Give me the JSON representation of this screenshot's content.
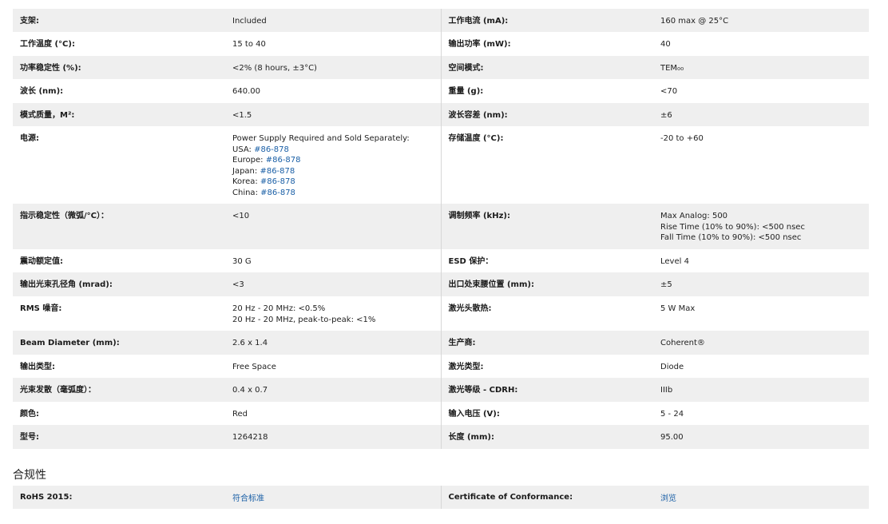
{
  "specs": [
    {
      "l1": "支架:",
      "v1": [
        "Included"
      ],
      "l2": "工作电流 (mA):",
      "v2": [
        "160 max @ 25°C"
      ],
      "h": 29
    },
    {
      "l1": "工作温度 (°C):",
      "v1": [
        "15 to 40"
      ],
      "l2": "输出功率 (mW):",
      "v2": [
        "40"
      ],
      "h": 30
    },
    {
      "l1": "功率稳定性 (%):",
      "v1": [
        "<2% (8 hours, ±3°C)"
      ],
      "l2": "空间模式:",
      "v2": [
        "TEM₀₀"
      ],
      "h": 29
    },
    {
      "l1": "波长 (nm):",
      "v1": [
        "640.00"
      ],
      "l2": "重量 (g):",
      "v2": [
        "<70"
      ],
      "h": 30
    },
    {
      "l1": "模式质量，M²:",
      "v1": [
        "<1.5"
      ],
      "l2": "波长容差 (nm):",
      "v2": [
        "±6"
      ],
      "h": 29
    },
    {
      "l1": "电源:",
      "v1": [
        [
          "Power Supply Required and Sold Separately:"
        ],
        [
          "USA: ",
          "#86-878"
        ],
        [
          "Europe: ",
          "#86-878"
        ],
        [
          "Japan: ",
          "#86-878"
        ],
        [
          "Korea: ",
          "#86-878"
        ],
        [
          "China: ",
          "#86-878"
        ]
      ],
      "l2": "存储温度 (°C):",
      "v2": [
        "-20 to +60"
      ],
      "h": 97
    },
    {
      "l1": "指示稳定性（微弧/°C）：",
      "v1": [
        "<10"
      ],
      "l2": "调制频率 (kHz):",
      "v2": [
        "Max Analog: 500",
        "Rise Time (10% to 90%): <500 nsec",
        "Fall Time (10% to 90%): <500 nsec"
      ],
      "h": 57
    },
    {
      "l1": "震动额定值:",
      "v1": [
        "30 G"
      ],
      "l2": "ESD 保护：",
      "v2": [
        "Level 4"
      ],
      "h": 29
    },
    {
      "l1": "输出光束孔径角 (mrad):",
      "v1": [
        "<3"
      ],
      "l2": "出口处束腰位置 (mm):",
      "v2": [
        "±5"
      ],
      "h": 30
    },
    {
      "l1": "RMS 噪音:",
      "v1": [
        "20 Hz - 20 MHz: <0.5%",
        "20 Hz - 20 MHz, peak-to-peak: <1%"
      ],
      "l2": "激光头散热:",
      "v2": [
        "5 W Max"
      ],
      "h": 43
    },
    {
      "l1": "Beam Diameter (mm):",
      "v1": [
        "2.6 x 1.4"
      ],
      "l2": "生产商:",
      "v2": [
        "Coherent®"
      ],
      "h": 30
    },
    {
      "l1": "输出类型:",
      "v1": [
        "Free Space"
      ],
      "l2": "激光类型:",
      "v2": [
        "Diode"
      ],
      "h": 29
    },
    {
      "l1": "光束发散（毫弧度）：",
      "v1": [
        "0.4 x 0.7"
      ],
      "l2": "激光等级 - CDRH:",
      "v2": [
        "IIIb"
      ],
      "h": 30
    },
    {
      "l1": "颜色:",
      "v1": [
        "Red"
      ],
      "l2": "输入电压 (V):",
      "v2": [
        "5 - 24"
      ],
      "h": 29
    },
    {
      "l1": "型号:",
      "v1": [
        "1264218"
      ],
      "l2": "长度 (mm):",
      "v2": [
        "95.00"
      ],
      "h": 30
    }
  ],
  "compliance": {
    "heading": "合规性",
    "l1": "RoHS 2015:",
    "v1": "符合标准",
    "l2": "Certificate of Conformance:",
    "v2": "浏览"
  }
}
